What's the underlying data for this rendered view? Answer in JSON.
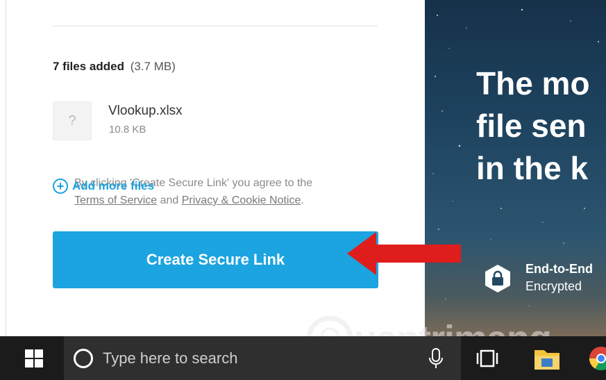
{
  "upload": {
    "files_count_label": "7 files added",
    "total_size": "(3.7 MB)",
    "file": {
      "thumbnail_glyph": "?",
      "name": "Vlookup.xlsx",
      "size": "10.8 KB"
    },
    "add_more_label": "Add more files",
    "agreement": {
      "prefix": "By clicking 'Create Secure Link' you agree to the",
      "terms_link": "Terms of Service",
      "and": "and",
      "privacy_link": "Privacy & Cookie Notice",
      "suffix": "."
    },
    "create_button_label": "Create Secure Link"
  },
  "hero": {
    "title_lines": [
      "The mo",
      "file sen",
      "in the k"
    ],
    "feature_line1": "End-to-End",
    "feature_line2": "Encrypted",
    "badge_icon": "lock-shield-icon"
  },
  "annotation": {
    "arrow_color": "#e01d1d"
  },
  "watermark": {
    "text": "uantrimang"
  },
  "taskbar": {
    "search_placeholder": "Type here to search",
    "start_icon": "windows-logo-icon",
    "icons": [
      "microphone-icon",
      "task-view-icon",
      "file-explorer-icon",
      "chrome-icon"
    ]
  },
  "colors": {
    "accent": "#1ba4e0",
    "taskbar": "#1b1b1b",
    "search_box": "#2f2f2f"
  }
}
